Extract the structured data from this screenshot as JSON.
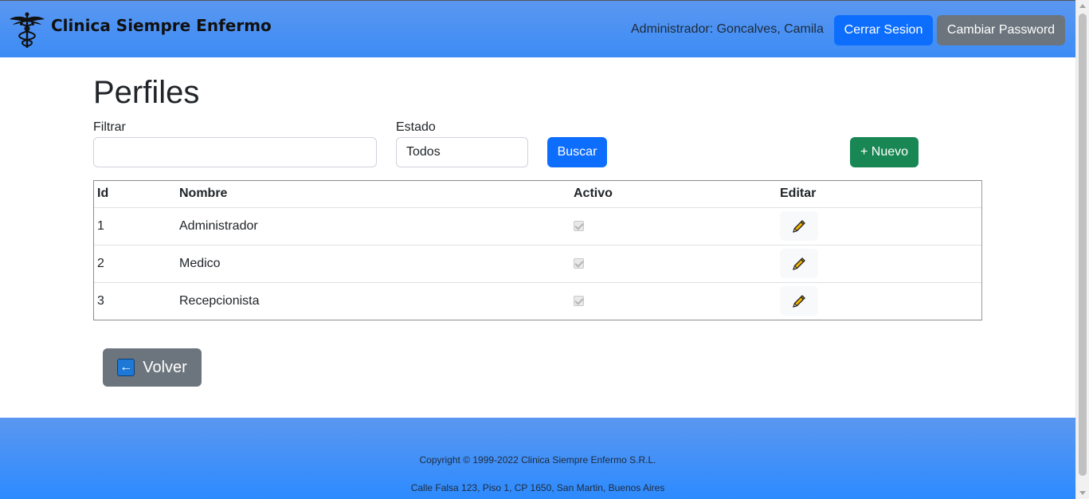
{
  "header": {
    "brand_title": "Clinica Siempre Enfermo",
    "user_label": "Administrador: Goncalves, Camila",
    "logout_label": "Cerrar Sesion",
    "password_label": "Cambiar Password"
  },
  "main": {
    "title": "Perfiles",
    "filter_label": "Filtrar",
    "filter_value": "",
    "status_label": "Estado",
    "status_value": "Todos",
    "search_label": "Buscar",
    "new_label": "+ Nuevo",
    "back_label": "Volver"
  },
  "table": {
    "headers": [
      "Id",
      "Nombre",
      "Activo",
      "Editar"
    ],
    "rows": [
      {
        "id": "1",
        "nombre": "Administrador",
        "activo": true
      },
      {
        "id": "2",
        "nombre": "Medico",
        "activo": true
      },
      {
        "id": "3",
        "nombre": "Recepcionista",
        "activo": true
      }
    ]
  },
  "footer": {
    "copyright": "Copyright © 1999-2022 Clinica Siempre Enfermo S.R.L.",
    "address": "Calle Falsa 123, Piso 1, CP 1650, San Martin, Buenos Aires"
  },
  "colors": {
    "header_bg": "#4f93f3",
    "primary": "#0d6efd",
    "secondary": "#6c757d",
    "success": "#198754"
  },
  "icons": {
    "logo": "caduceus-icon",
    "edit": "pencil-icon",
    "back": "left-arrow-icon"
  }
}
